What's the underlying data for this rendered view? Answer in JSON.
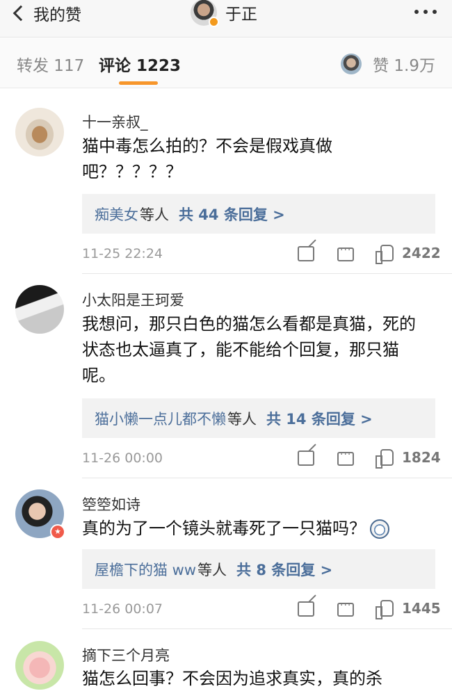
{
  "nav": {
    "back_label": "我的赞",
    "title": "于正"
  },
  "tabs": {
    "repost": "转发 117",
    "comment": "评论 1223",
    "like": "赞 1.9万"
  },
  "comments": [
    {
      "username": "十一亲叔_",
      "text": "猫中毒怎么拍的？不会是假戏真做吧？？？？？",
      "reply_who": "痴美女",
      "reply_etc": "等人",
      "reply_count": "共 44 条回复 >",
      "time": "11-25 22:24",
      "likes": "2422"
    },
    {
      "username": "小太阳是王珂爱",
      "text": "我想问，那只白色的猫怎么看都是真猫，死的状态也太逼真了，能不能给个回复，那只猫呢。",
      "reply_who": "猫小懒一点儿都不懒",
      "reply_etc": "等人",
      "reply_count": "共 14 条回复 >",
      "time": "11-26 00:00",
      "likes": "1824"
    },
    {
      "username": "箜箜如诗",
      "text": "真的为了一个镜头就毒死了一只猫吗？",
      "reply_who": "屋檐下的猫 ww",
      "reply_etc": "等人",
      "reply_count": "共 8 条回复 >",
      "time": "11-26 00:07",
      "likes": "1445"
    },
    {
      "username": "摘下三个月亮",
      "text": "猫怎么回事？不会因为追求真实，真的杀"
    }
  ],
  "icons": {
    "back": "chevron-left-icon",
    "more": "more-dots-icon",
    "share": "share-icon",
    "reply": "comment-icon",
    "like": "thumb-up-icon"
  },
  "colors": {
    "accent": "#f7962b",
    "link": "#4b6e9a"
  }
}
